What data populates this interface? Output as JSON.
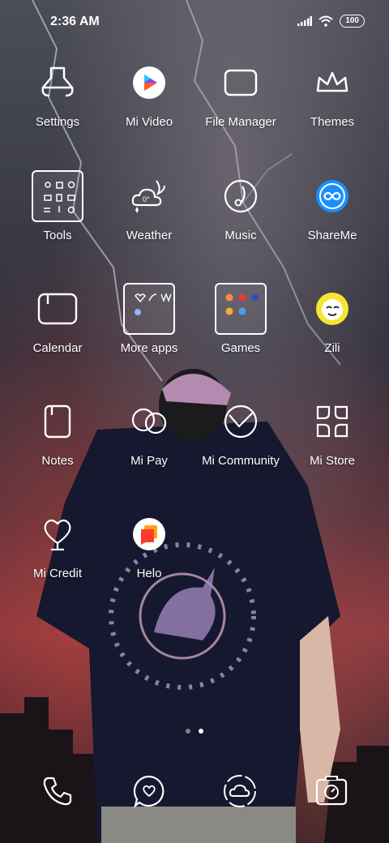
{
  "status": {
    "time": "2:36 AM",
    "battery": "100"
  },
  "apps": [
    {
      "name": "settings",
      "label": "Settings"
    },
    {
      "name": "mi-video",
      "label": "Mi Video"
    },
    {
      "name": "file-manager",
      "label": "File Manager"
    },
    {
      "name": "themes",
      "label": "Themes"
    },
    {
      "name": "tools",
      "label": "Tools"
    },
    {
      "name": "weather",
      "label": "Weather"
    },
    {
      "name": "music",
      "label": "Music"
    },
    {
      "name": "shareme",
      "label": "ShareMe"
    },
    {
      "name": "calendar",
      "label": "Calendar"
    },
    {
      "name": "more-apps",
      "label": "More apps"
    },
    {
      "name": "games",
      "label": "Games"
    },
    {
      "name": "zili",
      "label": "Zili"
    },
    {
      "name": "notes",
      "label": "Notes"
    },
    {
      "name": "mi-pay",
      "label": "Mi Pay"
    },
    {
      "name": "mi-community",
      "label": "Mi Community"
    },
    {
      "name": "mi-store",
      "label": "Mi Store"
    },
    {
      "name": "mi-credit",
      "label": "Mi Credit"
    },
    {
      "name": "helo",
      "label": "Helo"
    }
  ],
  "page_indicator": {
    "pages": 2,
    "current": 2
  },
  "dock": [
    "phone-icon",
    "messages-icon",
    "cloud-icon",
    "camera-icon"
  ],
  "colors": {
    "mi_video_accent": "#ff5a2a",
    "shareme_blue": "#1a8fff",
    "zili_yellow": "#f7e631",
    "helo_orange": "#ff6a1a"
  }
}
